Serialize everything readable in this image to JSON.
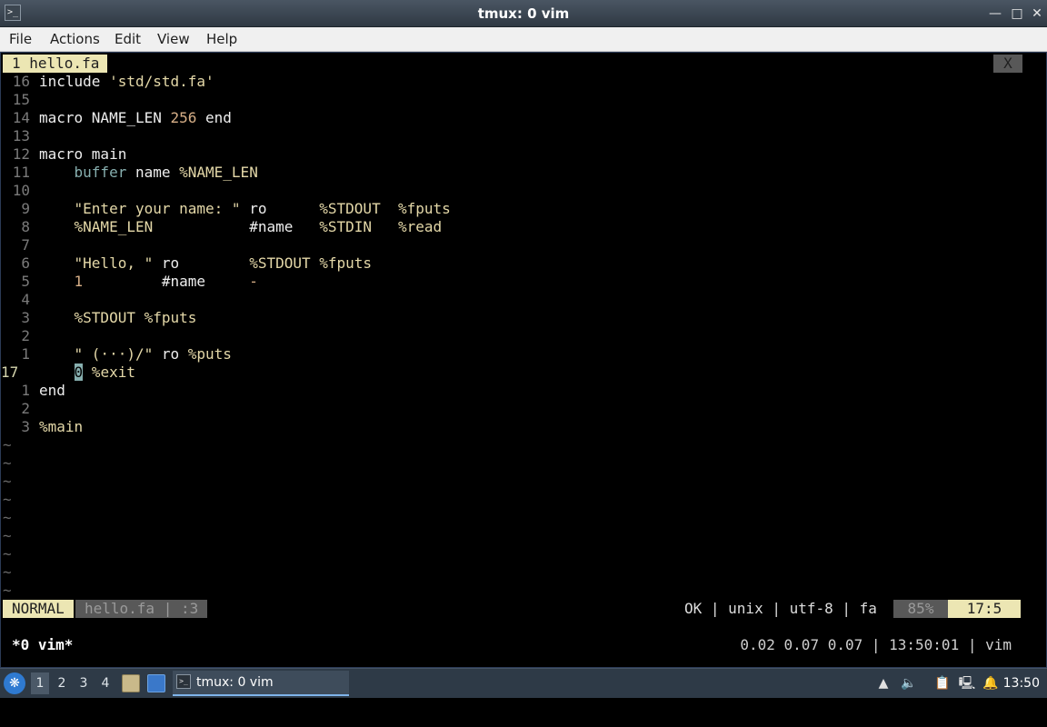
{
  "window": {
    "title": "tmux: 0 vim"
  },
  "menu": {
    "items": [
      "File",
      "Actions",
      "Edit",
      "View",
      "Help"
    ]
  },
  "vim": {
    "tab_label": "1 hello.fa",
    "close_label": "X",
    "lines": [
      {
        "num": "16",
        "tokens": [
          {
            "t": "include ",
            "c": "k"
          },
          {
            "t": "'std/std.fa'",
            "c": "s"
          }
        ]
      },
      {
        "num": "15",
        "tokens": []
      },
      {
        "num": "14",
        "tokens": [
          {
            "t": "macro NAME_LEN ",
            "c": "k"
          },
          {
            "t": "256",
            "c": "n"
          },
          {
            "t": " end",
            "c": "k"
          }
        ]
      },
      {
        "num": "13",
        "tokens": []
      },
      {
        "num": "12",
        "tokens": [
          {
            "t": "macro main",
            "c": "k"
          }
        ]
      },
      {
        "num": "11",
        "tokens": [
          {
            "t": "    ",
            "c": "k"
          },
          {
            "t": "buffer",
            "c": "t"
          },
          {
            "t": " name ",
            "c": "k"
          },
          {
            "t": "%NAME_LEN",
            "c": "m"
          }
        ]
      },
      {
        "num": "10",
        "tokens": []
      },
      {
        "num": "9",
        "tokens": [
          {
            "t": "    ",
            "c": "k"
          },
          {
            "t": "\"Enter your name: \"",
            "c": "s"
          },
          {
            "t": " ro      ",
            "c": "k"
          },
          {
            "t": "%STDOUT  %fputs",
            "c": "m"
          }
        ]
      },
      {
        "num": "8",
        "tokens": [
          {
            "t": "    ",
            "c": "k"
          },
          {
            "t": "%NAME_LEN",
            "c": "m"
          },
          {
            "t": "           #name   ",
            "c": "k"
          },
          {
            "t": "%STDIN   %read",
            "c": "m"
          }
        ]
      },
      {
        "num": "7",
        "tokens": []
      },
      {
        "num": "6",
        "tokens": [
          {
            "t": "    ",
            "c": "k"
          },
          {
            "t": "\"Hello, \"",
            "c": "s"
          },
          {
            "t": " ro        ",
            "c": "k"
          },
          {
            "t": "%STDOUT %fputs",
            "c": "m"
          }
        ]
      },
      {
        "num": "5",
        "tokens": [
          {
            "t": "    ",
            "c": "k"
          },
          {
            "t": "1",
            "c": "n"
          },
          {
            "t": "         #name     ",
            "c": "k"
          },
          {
            "t": "-",
            "c": "n"
          }
        ]
      },
      {
        "num": "4",
        "tokens": []
      },
      {
        "num": "3",
        "tokens": [
          {
            "t": "    ",
            "c": "k"
          },
          {
            "t": "%STDOUT %fputs",
            "c": "m"
          }
        ]
      },
      {
        "num": "2",
        "tokens": []
      },
      {
        "num": "1",
        "tokens": [
          {
            "t": "    ",
            "c": "k"
          },
          {
            "t": "\" (···)/\"",
            "c": "s"
          },
          {
            "t": " ro ",
            "c": "k"
          },
          {
            "t": "%puts",
            "c": "m"
          }
        ]
      },
      {
        "num": "17",
        "current": true,
        "tokens": [
          {
            "t": "    ",
            "c": "k"
          },
          {
            "t": "0",
            "c": "cursor"
          },
          {
            "t": " %exit",
            "c": "m"
          }
        ]
      },
      {
        "num": "1",
        "tokens": [
          {
            "t": "end",
            "c": "k"
          }
        ]
      },
      {
        "num": "2",
        "tokens": []
      },
      {
        "num": "3",
        "tokens": [
          {
            "t": "%main",
            "c": "m"
          }
        ]
      }
    ],
    "tilde_count": 9,
    "tilde_char": "~",
    "status": {
      "mode": "NORMAL",
      "file": "hello.fa | :3",
      "info": "OK | unix | utf-8 | fa",
      "percent": "85%",
      "position": "17:5"
    }
  },
  "tmux": {
    "window": "*0 vim*",
    "info": "0.02 0.07 0.07 | 13:50:01 | vim"
  },
  "taskbar": {
    "desktops": [
      "1",
      "2",
      "3",
      "4"
    ],
    "task_label": "tmux: 0 vim",
    "clock": "13:50"
  }
}
